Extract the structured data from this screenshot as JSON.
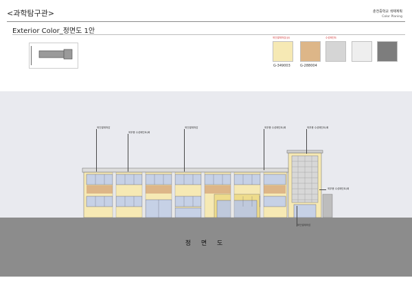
{
  "header": {
    "title": "<과학탐구관>",
    "subtitle": "Exterior Color_정면도   1안",
    "school": "춘천중학교  색채계획",
    "plan_label": "Color Planing"
  },
  "swatches": [
    {
      "color": "#f6e9b4",
      "top_label": "외단열재마감(상)",
      "code": "G-349003"
    },
    {
      "color": "#ddb688",
      "top_label": "",
      "code": "G-288004"
    },
    {
      "color": "#d5d5d5",
      "top_label": "수성페인트",
      "code": ""
    },
    {
      "color": "#eeeeee",
      "top_label": "",
      "code": ""
    },
    {
      "color": "#7d7d7d",
      "top_label": "",
      "code": ""
    }
  ],
  "callouts": {
    "c1": "외단열재마감",
    "c2": "외부용  수성페인트(회",
    "c3": "외단열재마감",
    "c4": "외부용  수성페인트(회",
    "c5": "외부용  수성페인트(회",
    "c6": "외부용  수성페인트(회",
    "c7": "외단열재마감"
  },
  "elevation": {
    "label": "정 면 도"
  },
  "colors": {
    "background_panel": "#e9eaef",
    "ground": "#8c8c8c",
    "wall_yellow": "#f6e9b4",
    "wall_tan": "#ddb688",
    "glass": "#b9c7de"
  }
}
